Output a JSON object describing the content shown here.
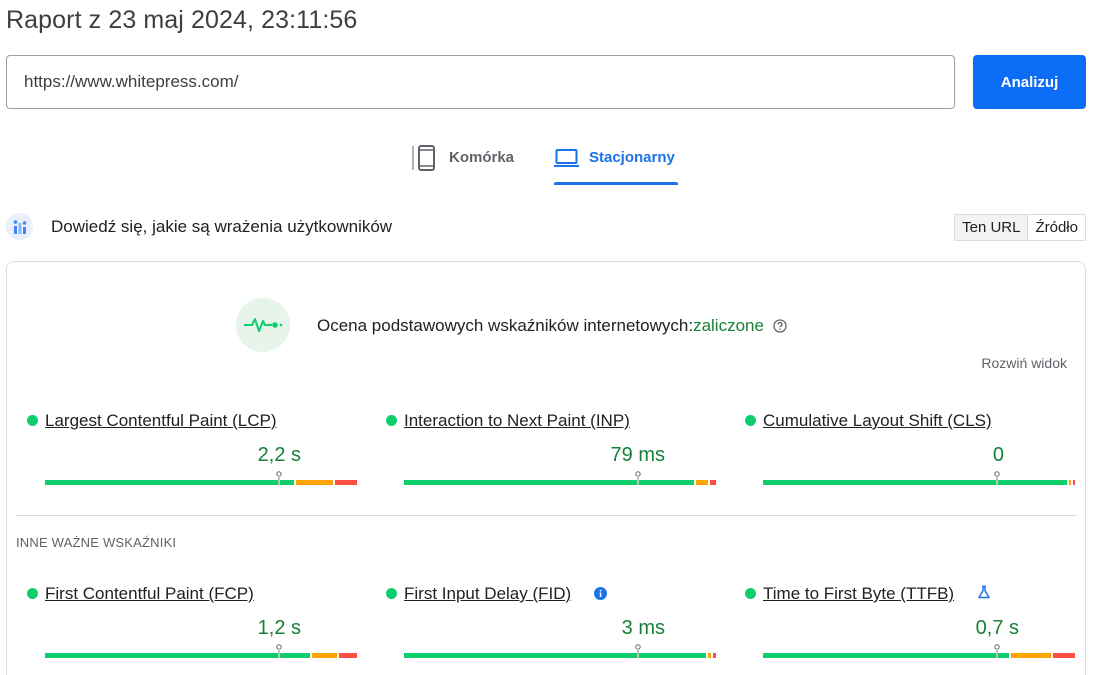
{
  "report": {
    "title": "Raport z 23 maj 2024, 23:11:56"
  },
  "search": {
    "url_value": "https://www.whitepress.com/",
    "analyze_label": "Analizuj"
  },
  "tabs": [
    {
      "label": "Komórka",
      "icon": "smartphone-icon",
      "active": false
    },
    {
      "label": "Stacjonarny",
      "icon": "laptop-icon",
      "active": true
    }
  ],
  "section": {
    "title": "Dowiedź się, jakie są wrażenia użytkowników",
    "toggle": [
      {
        "label": "Ten URL",
        "active": true
      },
      {
        "label": "Źródło",
        "active": false
      }
    ]
  },
  "assessment": {
    "label": "Ocena podstawowych wskaźników internetowych:",
    "status": "zaliczone",
    "expand_label": "Rozwiń widok"
  },
  "colors": {
    "good": "#0cce6b",
    "needs_improvement": "#ffa400",
    "poor": "#ff4e42",
    "accent": "#1a73e8",
    "value": "#188038"
  },
  "core_metrics": [
    {
      "name": "Largest Contentful Paint (LCP)",
      "value": "2,2 s",
      "distribution": {
        "good": 0.81,
        "needs_improvement": 0.12,
        "poor": 0.07
      },
      "marker": 0.75
    },
    {
      "name": "Interaction to Next Paint (INP)",
      "value": "79 ms",
      "distribution": {
        "good": 0.94,
        "needs_improvement": 0.04,
        "poor": 0.02
      },
      "marker": 0.75
    },
    {
      "name": "Cumulative Layout Shift (CLS)",
      "value": "0",
      "distribution": {
        "good": 0.987,
        "needs_improvement": 0.008,
        "poor": 0.005
      },
      "marker": 0.75
    }
  ],
  "other_heading": "INNE WAŻNE WSKAŹNIKI",
  "other_metrics": [
    {
      "name": "First Contentful Paint (FCP)",
      "value": "1,2 s",
      "icon": "",
      "distribution": {
        "good": 0.86,
        "needs_improvement": 0.08,
        "poor": 0.06
      },
      "marker": 0.75
    },
    {
      "name": "First Input Delay (FID)",
      "value": "3 ms",
      "icon": "info-icon",
      "distribution": {
        "good": 0.98,
        "needs_improvement": 0.01,
        "poor": 0.01
      },
      "marker": 0.75
    },
    {
      "name": "Time to First Byte (TTFB)",
      "value": "0,7 s",
      "icon": "lab-flask-icon",
      "distribution": {
        "good": 0.8,
        "needs_improvement": 0.13,
        "poor": 0.07
      },
      "marker": 0.75
    }
  ]
}
